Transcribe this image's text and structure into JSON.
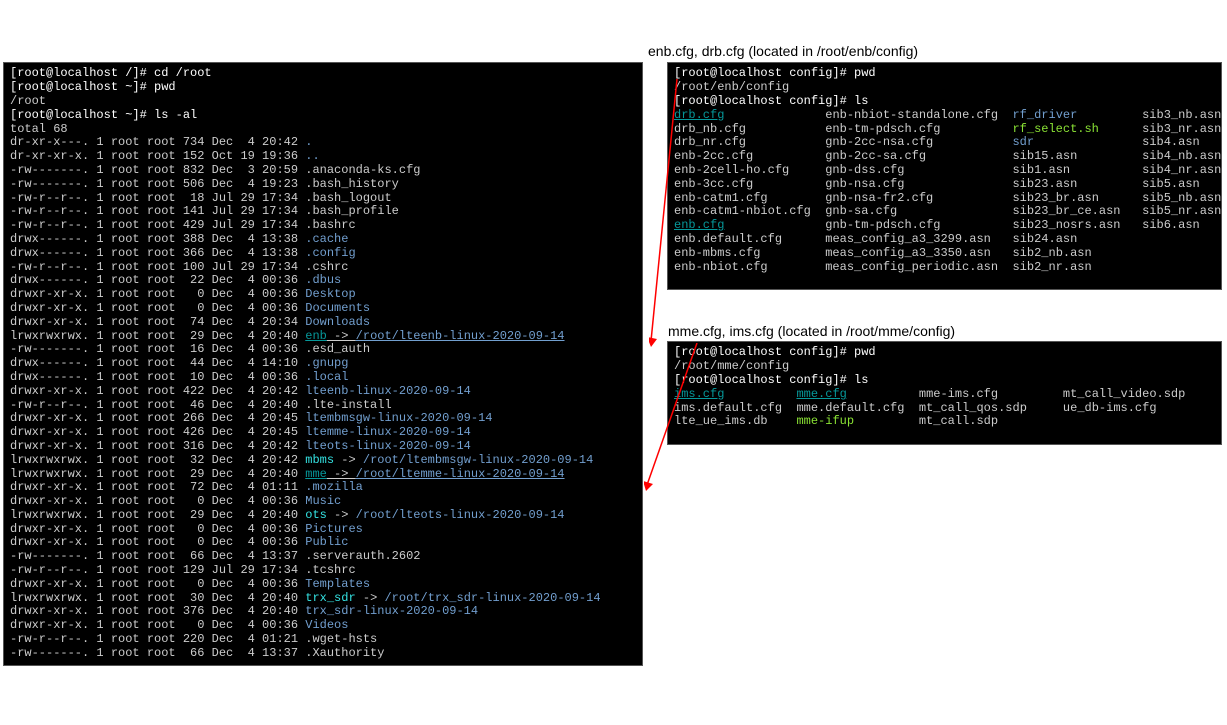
{
  "labels": {
    "enb": "enb.cfg, drb.cfg (located in /root/enb/config)",
    "mme": "mme.cfg, ims.cfg (located in /root/mme/config)"
  },
  "left": {
    "prompt1": "[root@localhost /]# cd /root",
    "prompt2": "[root@localhost ~]# pwd",
    "pwd": "/root",
    "prompt3": "[root@localhost ~]# ls -al",
    "total": "total 68",
    "rows": [
      {
        "p": "dr-xr-x---.",
        "l": "1",
        "u": "root",
        "g": "root",
        "s": "734",
        "d": "Dec  4 20:42",
        "n": ".",
        "cls": "c-dblue"
      },
      {
        "p": "dr-xr-xr-x.",
        "l": "1",
        "u": "root",
        "g": "root",
        "s": "152",
        "d": "Oct 19 19:36",
        "n": "..",
        "cls": "c-dblue"
      },
      {
        "p": "-rw-------.",
        "l": "1",
        "u": "root",
        "g": "root",
        "s": "832",
        "d": "Dec  3 20:59",
        "n": ".anaconda-ks.cfg",
        "cls": "c-gray"
      },
      {
        "p": "-rw-------.",
        "l": "1",
        "u": "root",
        "g": "root",
        "s": "506",
        "d": "Dec  4 19:23",
        "n": ".bash_history",
        "cls": "c-gray"
      },
      {
        "p": "-rw-r--r--.",
        "l": "1",
        "u": "root",
        "g": "root",
        "s": " 18",
        "d": "Jul 29 17:34",
        "n": ".bash_logout",
        "cls": "c-gray"
      },
      {
        "p": "-rw-r--r--.",
        "l": "1",
        "u": "root",
        "g": "root",
        "s": "141",
        "d": "Jul 29 17:34",
        "n": ".bash_profile",
        "cls": "c-gray"
      },
      {
        "p": "-rw-r--r--.",
        "l": "1",
        "u": "root",
        "g": "root",
        "s": "429",
        "d": "Jul 29 17:34",
        "n": ".bashrc",
        "cls": "c-gray"
      },
      {
        "p": "drwx------.",
        "l": "1",
        "u": "root",
        "g": "root",
        "s": "388",
        "d": "Dec  4 13:38",
        "n": ".cache",
        "cls": "c-dblue"
      },
      {
        "p": "drwx------.",
        "l": "1",
        "u": "root",
        "g": "root",
        "s": "366",
        "d": "Dec  4 13:38",
        "n": ".config",
        "cls": "c-dblue"
      },
      {
        "p": "-rw-r--r--.",
        "l": "1",
        "u": "root",
        "g": "root",
        "s": "100",
        "d": "Jul 29 17:34",
        "n": ".cshrc",
        "cls": "c-gray"
      },
      {
        "p": "drwx------.",
        "l": "1",
        "u": "root",
        "g": "root",
        "s": " 22",
        "d": "Dec  4 00:36",
        "n": ".dbus",
        "cls": "c-dblue"
      },
      {
        "p": "drwxr-xr-x.",
        "l": "1",
        "u": "root",
        "g": "root",
        "s": "  0",
        "d": "Dec  4 00:36",
        "n": "Desktop",
        "cls": "c-dblue"
      },
      {
        "p": "drwxr-xr-x.",
        "l": "1",
        "u": "root",
        "g": "root",
        "s": "  0",
        "d": "Dec  4 00:36",
        "n": "Documents",
        "cls": "c-dblue"
      },
      {
        "p": "drwxr-xr-x.",
        "l": "1",
        "u": "root",
        "g": "root",
        "s": " 74",
        "d": "Dec  4 20:34",
        "n": "Downloads",
        "cls": "c-dblue"
      },
      {
        "p": "lrwxrwxrwx.",
        "l": "1",
        "u": "root",
        "g": "root",
        "s": " 29",
        "d": "Dec  4 20:40",
        "n": "enb",
        "cls": "c-bcyan",
        "lnk": "/root/lteenb-linux-2020-09-14",
        "lcls": "c-dblue",
        "ul": true
      },
      {
        "p": "-rw-------.",
        "l": "1",
        "u": "root",
        "g": "root",
        "s": " 16",
        "d": "Dec  4 00:36",
        "n": ".esd_auth",
        "cls": "c-gray"
      },
      {
        "p": "drwx------.",
        "l": "1",
        "u": "root",
        "g": "root",
        "s": " 44",
        "d": "Dec  4 14:10",
        "n": ".gnupg",
        "cls": "c-dblue"
      },
      {
        "p": "drwx------.",
        "l": "1",
        "u": "root",
        "g": "root",
        "s": " 10",
        "d": "Dec  4 00:36",
        "n": ".local",
        "cls": "c-dblue"
      },
      {
        "p": "drwxr-xr-x.",
        "l": "1",
        "u": "root",
        "g": "root",
        "s": "422",
        "d": "Dec  4 20:42",
        "n": "lteenb-linux-2020-09-14",
        "cls": "c-dblue"
      },
      {
        "p": "-rw-r--r--.",
        "l": "1",
        "u": "root",
        "g": "root",
        "s": " 46",
        "d": "Dec  4 20:40",
        "n": ".lte-install",
        "cls": "c-gray"
      },
      {
        "p": "drwxr-xr-x.",
        "l": "1",
        "u": "root",
        "g": "root",
        "s": "266",
        "d": "Dec  4 20:45",
        "n": "ltembmsgw-linux-2020-09-14",
        "cls": "c-dblue"
      },
      {
        "p": "drwxr-xr-x.",
        "l": "1",
        "u": "root",
        "g": "root",
        "s": "426",
        "d": "Dec  4 20:45",
        "n": "ltemme-linux-2020-09-14",
        "cls": "c-dblue"
      },
      {
        "p": "drwxr-xr-x.",
        "l": "1",
        "u": "root",
        "g": "root",
        "s": "316",
        "d": "Dec  4 20:42",
        "n": "lteots-linux-2020-09-14",
        "cls": "c-dblue"
      },
      {
        "p": "lrwxrwxrwx.",
        "l": "1",
        "u": "root",
        "g": "root",
        "s": " 32",
        "d": "Dec  4 20:42",
        "n": "mbms",
        "cls": "c-cyan",
        "lnk": "/root/ltembmsgw-linux-2020-09-14",
        "lcls": "c-dblue"
      },
      {
        "p": "lrwxrwxrwx.",
        "l": "1",
        "u": "root",
        "g": "root",
        "s": " 29",
        "d": "Dec  4 20:40",
        "n": "mme",
        "cls": "c-bcyan",
        "lnk": "/root/ltemme-linux-2020-09-14",
        "lcls": "c-dblue",
        "ul": true
      },
      {
        "p": "drwxr-xr-x.",
        "l": "1",
        "u": "root",
        "g": "root",
        "s": " 72",
        "d": "Dec  4 01:11",
        "n": ".mozilla",
        "cls": "c-dblue"
      },
      {
        "p": "drwxr-xr-x.",
        "l": "1",
        "u": "root",
        "g": "root",
        "s": "  0",
        "d": "Dec  4 00:36",
        "n": "Music",
        "cls": "c-dblue"
      },
      {
        "p": "lrwxrwxrwx.",
        "l": "1",
        "u": "root",
        "g": "root",
        "s": " 29",
        "d": "Dec  4 20:40",
        "n": "ots",
        "cls": "c-cyan",
        "lnk": "/root/lteots-linux-2020-09-14",
        "lcls": "c-dblue"
      },
      {
        "p": "drwxr-xr-x.",
        "l": "1",
        "u": "root",
        "g": "root",
        "s": "  0",
        "d": "Dec  4 00:36",
        "n": "Pictures",
        "cls": "c-dblue"
      },
      {
        "p": "drwxr-xr-x.",
        "l": "1",
        "u": "root",
        "g": "root",
        "s": "  0",
        "d": "Dec  4 00:36",
        "n": "Public",
        "cls": "c-dblue"
      },
      {
        "p": "-rw-------.",
        "l": "1",
        "u": "root",
        "g": "root",
        "s": " 66",
        "d": "Dec  4 13:37",
        "n": ".serverauth.2602",
        "cls": "c-gray"
      },
      {
        "p": "-rw-r--r--.",
        "l": "1",
        "u": "root",
        "g": "root",
        "s": "129",
        "d": "Jul 29 17:34",
        "n": ".tcshrc",
        "cls": "c-gray"
      },
      {
        "p": "drwxr-xr-x.",
        "l": "1",
        "u": "root",
        "g": "root",
        "s": "  0",
        "d": "Dec  4 00:36",
        "n": "Templates",
        "cls": "c-dblue"
      },
      {
        "p": "lrwxrwxrwx.",
        "l": "1",
        "u": "root",
        "g": "root",
        "s": " 30",
        "d": "Dec  4 20:40",
        "n": "trx_sdr",
        "cls": "c-cyan",
        "lnk": "/root/trx_sdr-linux-2020-09-14",
        "lcls": "c-dblue"
      },
      {
        "p": "drwxr-xr-x.",
        "l": "1",
        "u": "root",
        "g": "root",
        "s": "376",
        "d": "Dec  4 20:40",
        "n": "trx_sdr-linux-2020-09-14",
        "cls": "c-dblue"
      },
      {
        "p": "drwxr-xr-x.",
        "l": "1",
        "u": "root",
        "g": "root",
        "s": "  0",
        "d": "Dec  4 00:36",
        "n": "Videos",
        "cls": "c-dblue"
      },
      {
        "p": "-rw-r--r--.",
        "l": "1",
        "u": "root",
        "g": "root",
        "s": "220",
        "d": "Dec  4 01:21",
        "n": ".wget-hsts",
        "cls": "c-gray"
      },
      {
        "p": "-rw-------.",
        "l": "1",
        "u": "root",
        "g": "root",
        "s": " 66",
        "d": "Dec  4 13:37",
        "n": ".Xauthority",
        "cls": "c-gray"
      }
    ]
  },
  "rtop": {
    "prompt1": "[root@localhost config]# pwd",
    "pwd": "/root/enb/config",
    "prompt2": "[root@localhost config]# ls",
    "cols": [
      [
        {
          "t": "drb.cfg",
          "c": "c-bcyan"
        },
        {
          "t": "drb_nb.cfg",
          "c": "c-gray"
        },
        {
          "t": "drb_nr.cfg",
          "c": "c-gray"
        },
        {
          "t": "enb-2cc.cfg",
          "c": "c-gray"
        },
        {
          "t": "enb-2cell-ho.cfg",
          "c": "c-gray"
        },
        {
          "t": "enb-3cc.cfg",
          "c": "c-gray"
        },
        {
          "t": "enb-catm1.cfg",
          "c": "c-gray"
        },
        {
          "t": "enb-catm1-nbiot.cfg",
          "c": "c-gray"
        },
        {
          "t": "enb.cfg",
          "c": "c-bcyan"
        },
        {
          "t": "enb.default.cfg",
          "c": "c-gray"
        },
        {
          "t": "enb-mbms.cfg",
          "c": "c-gray"
        },
        {
          "t": "enb-nbiot.cfg",
          "c": "c-gray"
        }
      ],
      [
        {
          "t": "enb-nbiot-standalone.cfg",
          "c": "c-gray"
        },
        {
          "t": "enb-tm-pdsch.cfg",
          "c": "c-gray"
        },
        {
          "t": "gnb-2cc-nsa.cfg",
          "c": "c-gray"
        },
        {
          "t": "gnb-2cc-sa.cfg",
          "c": "c-gray"
        },
        {
          "t": "gnb-dss.cfg",
          "c": "c-gray"
        },
        {
          "t": "gnb-nsa.cfg",
          "c": "c-gray"
        },
        {
          "t": "gnb-nsa-fr2.cfg",
          "c": "c-gray"
        },
        {
          "t": "gnb-sa.cfg",
          "c": "c-gray"
        },
        {
          "t": "gnb-tm-pdsch.cfg",
          "c": "c-gray"
        },
        {
          "t": "meas_config_a3_3299.asn",
          "c": "c-gray"
        },
        {
          "t": "meas_config_a3_3350.asn",
          "c": "c-gray"
        },
        {
          "t": "meas_config_periodic.asn",
          "c": "c-gray"
        }
      ],
      [
        {
          "t": "rf_driver",
          "c": "c-dblue"
        },
        {
          "t": "rf_select.sh",
          "c": "c-green"
        },
        {
          "t": "sdr",
          "c": "c-dblue"
        },
        {
          "t": "sib15.asn",
          "c": "c-gray"
        },
        {
          "t": "sib1.asn",
          "c": "c-gray"
        },
        {
          "t": "sib23.asn",
          "c": "c-gray"
        },
        {
          "t": "sib23_br.asn",
          "c": "c-gray"
        },
        {
          "t": "sib23_br_ce.asn",
          "c": "c-gray"
        },
        {
          "t": "sib23_nosrs.asn",
          "c": "c-gray"
        },
        {
          "t": "sib24.asn",
          "c": "c-gray"
        },
        {
          "t": "sib2_nb.asn",
          "c": "c-gray"
        },
        {
          "t": "sib2_nr.asn",
          "c": "c-gray"
        }
      ],
      [
        {
          "t": "sib3_nb.asn",
          "c": "c-gray"
        },
        {
          "t": "sib3_nr.asn",
          "c": "c-gray"
        },
        {
          "t": "sib4.asn",
          "c": "c-gray"
        },
        {
          "t": "sib4_nb.asn",
          "c": "c-gray"
        },
        {
          "t": "sib4_nr.asn",
          "c": "c-gray"
        },
        {
          "t": "sib5.asn",
          "c": "c-gray"
        },
        {
          "t": "sib5_nb.asn",
          "c": "c-gray"
        },
        {
          "t": "sib5_nr.asn",
          "c": "c-gray"
        },
        {
          "t": "sib6.asn",
          "c": "c-gray"
        }
      ]
    ],
    "widths": [
      21,
      26,
      18,
      14
    ]
  },
  "rbot": {
    "prompt1": "[root@localhost config]# pwd",
    "pwd": "/root/mme/config",
    "prompt2": "[root@localhost config]# ls",
    "cols": [
      [
        {
          "t": "ims.cfg",
          "c": "c-bcyan"
        },
        {
          "t": "ims.default.cfg",
          "c": "c-gray"
        },
        {
          "t": "lte_ue_ims.db",
          "c": "c-gray"
        }
      ],
      [
        {
          "t": "mme.cfg",
          "c": "c-bcyan"
        },
        {
          "t": "mme.default.cfg",
          "c": "c-gray"
        },
        {
          "t": "mme-ifup",
          "c": "c-green"
        }
      ],
      [
        {
          "t": "mme-ims.cfg",
          "c": "c-gray"
        },
        {
          "t": "mt_call_qos.sdp",
          "c": "c-gray"
        },
        {
          "t": "mt_call.sdp",
          "c": "c-gray"
        }
      ],
      [
        {
          "t": "mt_call_video.sdp",
          "c": "c-gray"
        },
        {
          "t": "ue_db-ims.cfg",
          "c": "c-gray"
        }
      ]
    ],
    "widths": [
      17,
      17,
      20,
      20
    ]
  }
}
